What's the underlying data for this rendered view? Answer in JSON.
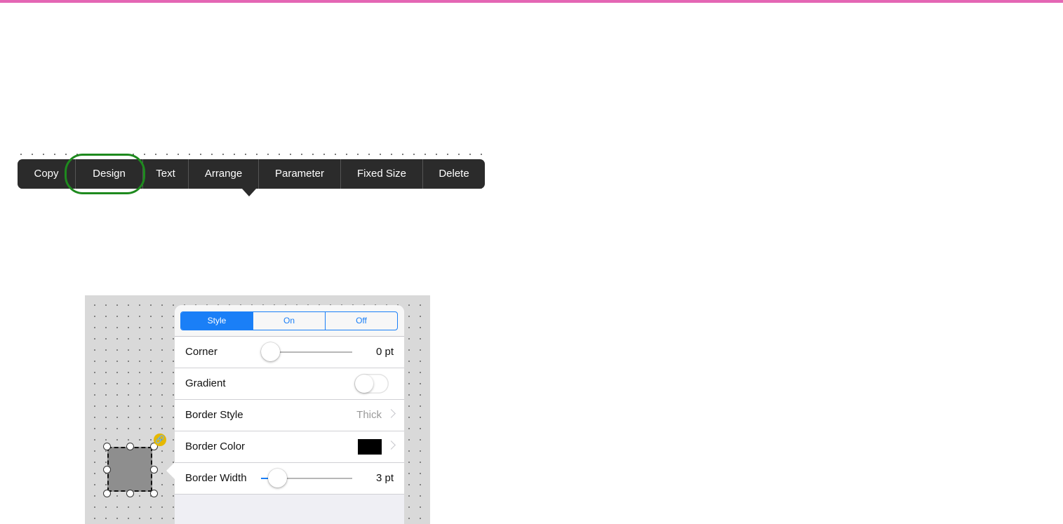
{
  "colors": {
    "top_bar": "#e466b4",
    "menu_background": "#2b2b2b",
    "highlight_ring": "#1e8a1e",
    "accent": "#1a7ff7",
    "border_color_swatch": "#000000"
  },
  "edit_menu": {
    "items": [
      {
        "label": "Copy"
      },
      {
        "label": "Design"
      },
      {
        "label": "Text"
      },
      {
        "label": "Arrange"
      },
      {
        "label": "Parameter"
      },
      {
        "label": "Fixed Size"
      },
      {
        "label": "Delete"
      }
    ],
    "highlighted_item": "Design"
  },
  "design_popover": {
    "tabs": [
      {
        "label": "Style",
        "selected": true
      },
      {
        "label": "On",
        "selected": false
      },
      {
        "label": "Off",
        "selected": false
      }
    ],
    "corner": {
      "label": "Corner",
      "value": "0 pt",
      "slider_fraction": 0
    },
    "gradient": {
      "label": "Gradient",
      "enabled": false
    },
    "border_style": {
      "label": "Border Style",
      "value": "Thick"
    },
    "border_color": {
      "label": "Border Color",
      "color": "#000000"
    },
    "border_width": {
      "label": "Border Width",
      "value": "3 pt",
      "slider_fraction": 0.05
    }
  },
  "shape": {
    "fill": "#8e8e8e",
    "link_badge_icon": "link-icon"
  }
}
